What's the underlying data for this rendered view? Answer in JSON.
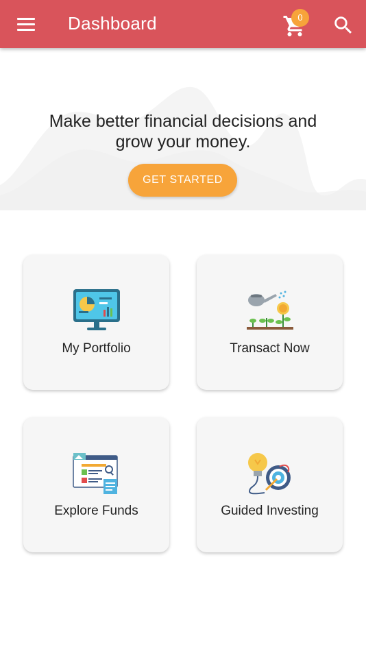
{
  "appbar": {
    "title": "Dashboard",
    "cart_count": "0",
    "menu_icon": "hamburger-menu-icon",
    "cart_icon": "shopping-cart-icon",
    "search_icon": "search-icon",
    "color": "#d9545b"
  },
  "hero": {
    "headline_line1": "Make better financial decisions and",
    "headline_line2": "grow your money.",
    "cta_label": "GET STARTED",
    "cta_color": "#f7a43a"
  },
  "tiles": [
    {
      "label": "My Portfolio",
      "icon": "portfolio-monitor-icon"
    },
    {
      "label": "Transact Now",
      "icon": "watering-can-coins-icon"
    },
    {
      "label": "Explore Funds",
      "icon": "funds-browser-icon"
    },
    {
      "label": "Guided Investing",
      "icon": "lightbulb-target-icon"
    }
  ]
}
